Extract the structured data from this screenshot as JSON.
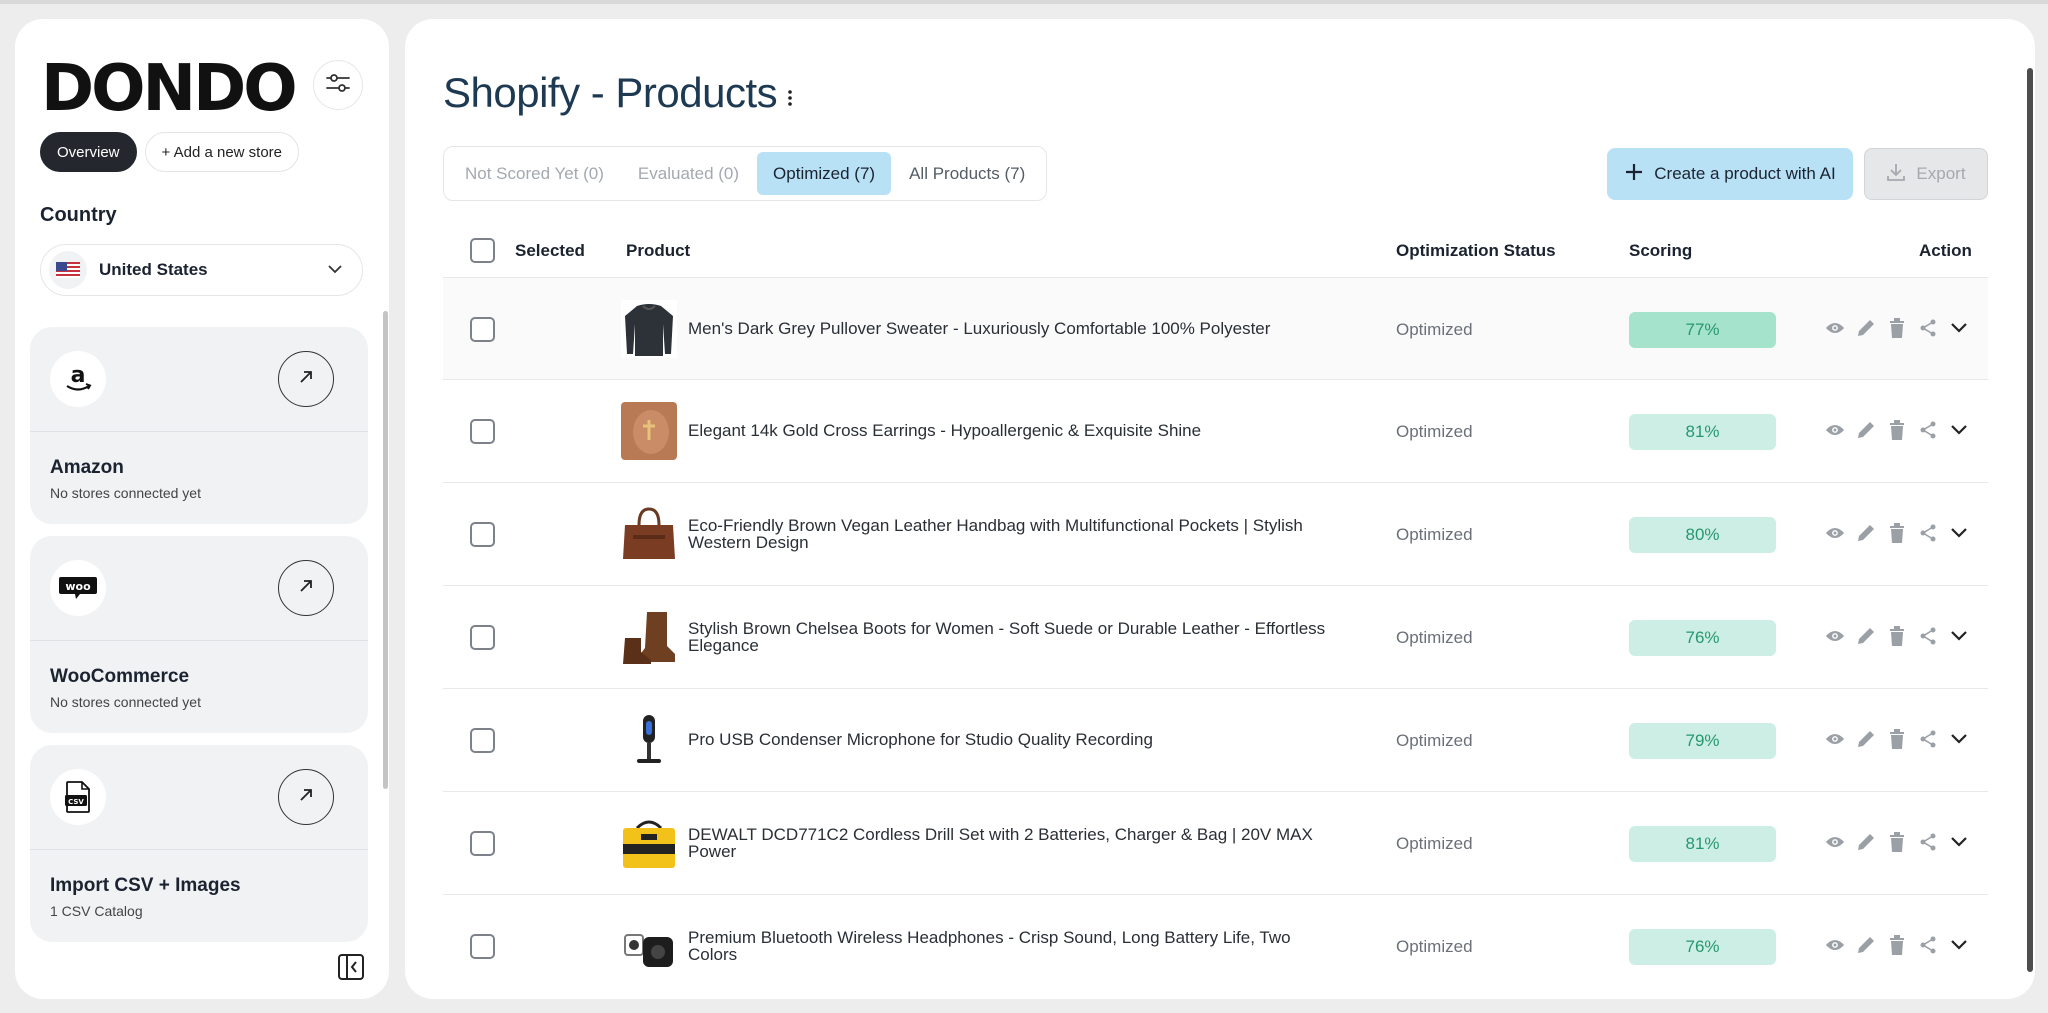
{
  "brand": {
    "logo_text": "DONDO"
  },
  "sidebar": {
    "pills": [
      {
        "label": "Overview",
        "active": true
      },
      {
        "label": "+ Add a new store",
        "active": false
      }
    ],
    "country_label": "Country",
    "country_value": "United States",
    "stores": [
      {
        "name": "Amazon",
        "subtitle": "No stores connected yet",
        "icon": "amazon-logo-icon"
      },
      {
        "name": "WooCommerce",
        "subtitle": "No stores connected yet",
        "icon": "woo-logo-icon",
        "logo_text": "woo"
      },
      {
        "name": "Import CSV + Images",
        "subtitle": "1 CSV Catalog",
        "icon": "csv-file-icon",
        "logo_text": "CSV"
      }
    ]
  },
  "main": {
    "title": "Shopify - Products",
    "tabs": [
      {
        "label": "Not Scored Yet (0)",
        "active": false
      },
      {
        "label": "Evaluated (0)",
        "active": false
      },
      {
        "label": "Optimized (7)",
        "active": true
      },
      {
        "label": "All Products (7)",
        "active": false
      }
    ],
    "create_label": "Create a product with AI",
    "export_label": "Export",
    "columns": {
      "selected": "Selected",
      "product": "Product",
      "status": "Optimization Status",
      "scoring": "Scoring",
      "action": "Action"
    },
    "products": [
      {
        "name": "Men's Dark Grey Pullover Sweater - Luxuriously Comfortable 100% Polyester",
        "status": "Optimized",
        "score": "77%"
      },
      {
        "name": "Elegant 14k Gold Cross Earrings - Hypoallergenic & Exquisite Shine",
        "status": "Optimized",
        "score": "81%"
      },
      {
        "name": "Eco-Friendly Brown Vegan Leather Handbag with Multifunctional Pockets | Stylish Western Design",
        "status": "Optimized",
        "score": "80%"
      },
      {
        "name": "Stylish Brown Chelsea Boots for Women - Soft Suede or Durable Leather - Effortless Elegance",
        "status": "Optimized",
        "score": "76%"
      },
      {
        "name": "Pro USB Condenser Microphone for Studio Quality Recording",
        "status": "Optimized",
        "score": "79%"
      },
      {
        "name": "DEWALT DCD771C2 Cordless Drill Set with 2 Batteries, Charger & Bag | 20V MAX Power",
        "status": "Optimized",
        "score": "81%"
      },
      {
        "name": "Premium Bluetooth Wireless Headphones - Crisp Sound, Long Battery Life, Two Colors",
        "status": "Optimized",
        "score": "76%"
      }
    ]
  },
  "colors": {
    "accent_blue": "#b8e1f6",
    "score_bg": "#cdeee4",
    "score_text": "#26986f",
    "title_color": "#1e3a52"
  }
}
